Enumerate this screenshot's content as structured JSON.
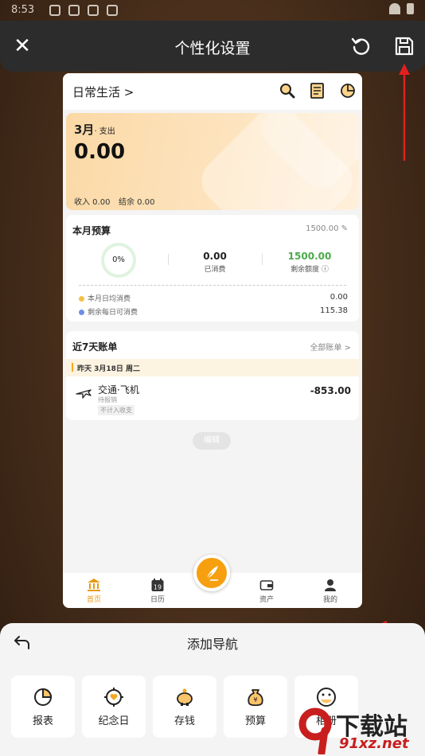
{
  "status_bar": {
    "time": "8:53"
  },
  "top_bar": {
    "title": "个性化设置"
  },
  "preview": {
    "header": {
      "book_name": "日常生活 >"
    },
    "expense_card": {
      "month": "3月",
      "month_suffix": "· 支出",
      "amount": "0.00",
      "income_label": "收入 0.00",
      "balance_label": "结余 0.00"
    },
    "budget": {
      "title": "本月预算",
      "total": "1500.00 ✎",
      "percent": "0%",
      "spent_value": "0.00",
      "spent_label": "已消费",
      "remaining_value": "1500.00",
      "remaining_label": "剩余额度 ⓘ",
      "daily_avg_label": "本月日均消费",
      "daily_avg_value": "0.00",
      "daily_left_label": "剩余每日可消费",
      "daily_left_value": "115.38"
    },
    "bills": {
      "title": "近7天账单",
      "all_link": "全部账单 >",
      "day_header": "昨天 3月18日 周二",
      "items": [
        {
          "category": "交通·飞机",
          "sub": "待报销",
          "tag": "不计入收支",
          "amount": "-853.00"
        }
      ]
    },
    "edit_label": "编辑",
    "tabs": [
      {
        "label": "首页",
        "icon": "bank-icon"
      },
      {
        "label": "日历",
        "icon": "calendar-icon"
      },
      {
        "label": "资产",
        "icon": "wallet-icon"
      },
      {
        "label": "我的",
        "icon": "user-icon"
      }
    ],
    "calendar_day": "19"
  },
  "panel": {
    "title": "添加导航",
    "items": [
      {
        "label": "报表",
        "icon": "pie-chart-icon"
      },
      {
        "label": "纪念日",
        "icon": "heart-target-icon"
      },
      {
        "label": "存钱",
        "icon": "piggy-bank-icon"
      },
      {
        "label": "预算",
        "icon": "money-bag-icon"
      },
      {
        "label": "相册",
        "icon": "album-face-icon"
      }
    ]
  },
  "watermark": {
    "brand": "下载站",
    "domain": "91xz.net"
  },
  "colors": {
    "accent": "#f6a010",
    "positive": "#4caa4c",
    "annotation_arrow": "#e02020"
  }
}
